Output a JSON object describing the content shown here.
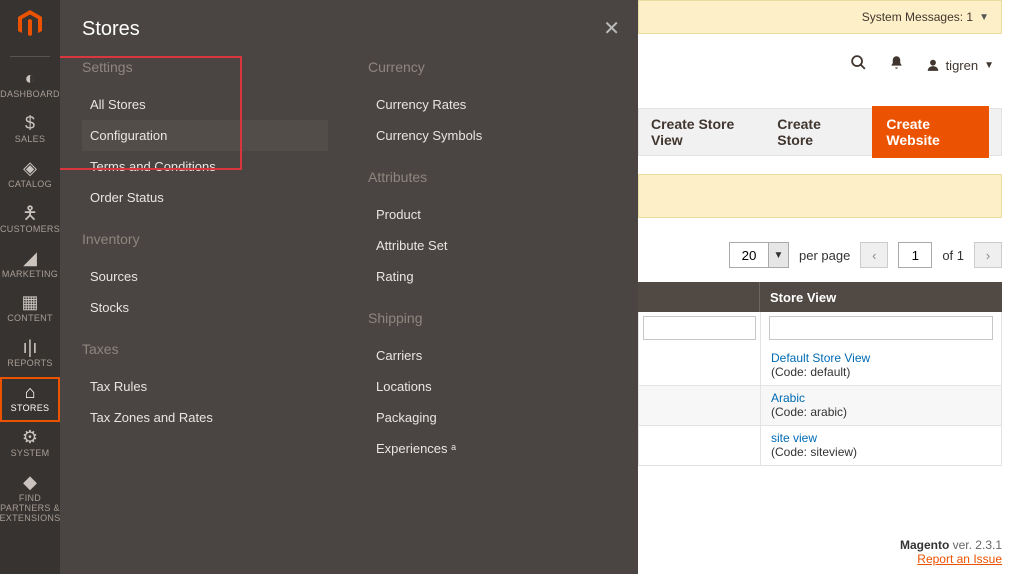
{
  "sidebar": {
    "items": [
      {
        "label": "DASHBOARD"
      },
      {
        "label": "SALES"
      },
      {
        "label": "CATALOG"
      },
      {
        "label": "CUSTOMERS"
      },
      {
        "label": "MARKETING"
      },
      {
        "label": "CONTENT"
      },
      {
        "label": "REPORTS"
      },
      {
        "label": "STORES"
      },
      {
        "label": "SYSTEM"
      },
      {
        "label": "FIND PARTNERS & EXTENSIONS"
      }
    ]
  },
  "flyout": {
    "title": "Stores",
    "col1": {
      "g1": {
        "title": "Settings",
        "items": [
          "All Stores",
          "Configuration",
          "Terms and Conditions",
          "Order Status"
        ]
      },
      "g2": {
        "title": "Inventory",
        "items": [
          "Sources",
          "Stocks"
        ]
      },
      "g3": {
        "title": "Taxes",
        "items": [
          "Tax Rules",
          "Tax Zones and Rates"
        ]
      }
    },
    "col2": {
      "g1": {
        "title": "Currency",
        "items": [
          "Currency Rates",
          "Currency Symbols"
        ]
      },
      "g2": {
        "title": "Attributes",
        "items": [
          "Product",
          "Attribute Set",
          "Rating"
        ]
      },
      "g3": {
        "title": "Shipping",
        "items": [
          "Carriers",
          "Locations",
          "Packaging",
          "Experiences ᵃ"
        ]
      }
    }
  },
  "sysmsg": {
    "text": "System Messages: 1"
  },
  "topbar": {
    "user": "tigren"
  },
  "actions": {
    "create_view": "Create Store View",
    "create_store": "Create Store",
    "create_website": "Create Website"
  },
  "pager": {
    "perpage": "20",
    "perpage_label": "per page",
    "page": "1",
    "of": "of 1"
  },
  "grid": {
    "head": "Store View",
    "rows": [
      {
        "name": "Default Store View",
        "code": "(Code: default)"
      },
      {
        "name": "Arabic",
        "code": "(Code: arabic)"
      },
      {
        "name": "site view",
        "code": "(Code: siteview)"
      }
    ]
  },
  "footer": {
    "brand": "Magento",
    "ver": " ver. 2.3.1",
    "report": "Report an Issue"
  }
}
